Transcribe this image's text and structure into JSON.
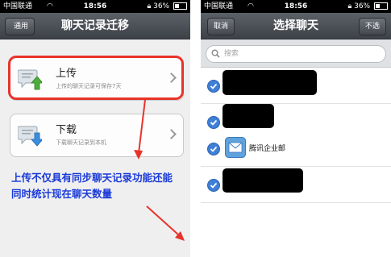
{
  "status_bar": {
    "carrier": "中国联通",
    "time": "18:56",
    "battery": "36%"
  },
  "left_screen": {
    "back_button": "通用",
    "title": "聊天记录迁移",
    "upload": {
      "title": "上传",
      "subtitle": "上传的聊天记录可保存7天"
    },
    "download": {
      "title": "下载",
      "subtitle": "下载聊天记录到本机"
    },
    "annotation": "上传不仅具有同步聊天记录功能还能同时统计现在聊天数量"
  },
  "right_screen": {
    "cancel_button": "取消",
    "title": "选择聊天",
    "deselect_button": "不选",
    "search_placeholder": "搜索",
    "contacts": [
      {
        "name": "",
        "redacted": true
      },
      {
        "name": "",
        "redacted": true
      },
      {
        "name": "腾讯企业邮",
        "redacted": false
      },
      {
        "name": "",
        "redacted": true
      }
    ]
  },
  "colors": {
    "highlight": "#e8332a",
    "annotation": "#1a3ad8",
    "check": "#3f7fd6"
  }
}
